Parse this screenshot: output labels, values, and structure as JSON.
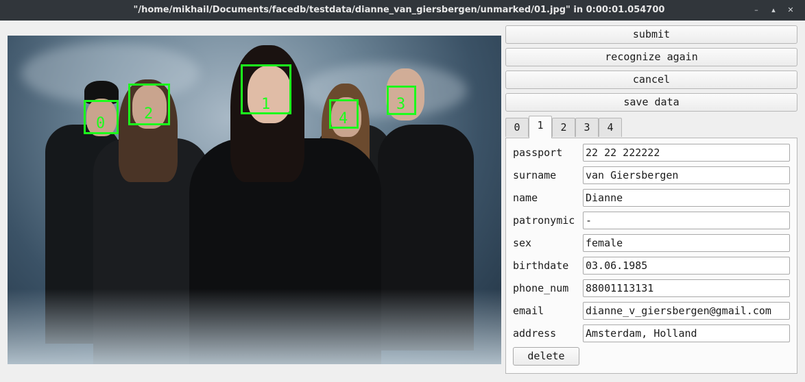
{
  "window": {
    "title": "\"/home/mikhail/Documents/facedb/testdata/dianne_van_giersbergen/unmarked/01.jpg\" in 0:00:01.054700",
    "controls": [
      "minimize-icon",
      "restore-icon",
      "close-icon"
    ]
  },
  "photo": {
    "faces": [
      "0",
      "1",
      "2",
      "3",
      "4"
    ],
    "box_color": "#1cff1c"
  },
  "actions": {
    "submit": "submit",
    "recognize_again": "recognize again",
    "cancel": "cancel",
    "save_data": "save data"
  },
  "tabs": [
    "0",
    "1",
    "2",
    "3",
    "4"
  ],
  "active_tab": "1",
  "form": {
    "passport": {
      "label": "passport",
      "value": "22 22 222222"
    },
    "surname": {
      "label": "surname",
      "value": "van Giersbergen"
    },
    "name": {
      "label": "name",
      "value": "Dianne"
    },
    "patronymic": {
      "label": "patronymic",
      "value": "-"
    },
    "sex": {
      "label": "sex",
      "value": "female"
    },
    "birthdate": {
      "label": "birthdate",
      "value": "03.06.1985"
    },
    "phone_num": {
      "label": "phone_num",
      "value": "88001113131"
    },
    "email": {
      "label": "email",
      "value": "dianne_v_giersbergen@gmail.com"
    },
    "address": {
      "label": "address",
      "value": "Amsterdam, Holland"
    },
    "delete": "delete"
  }
}
